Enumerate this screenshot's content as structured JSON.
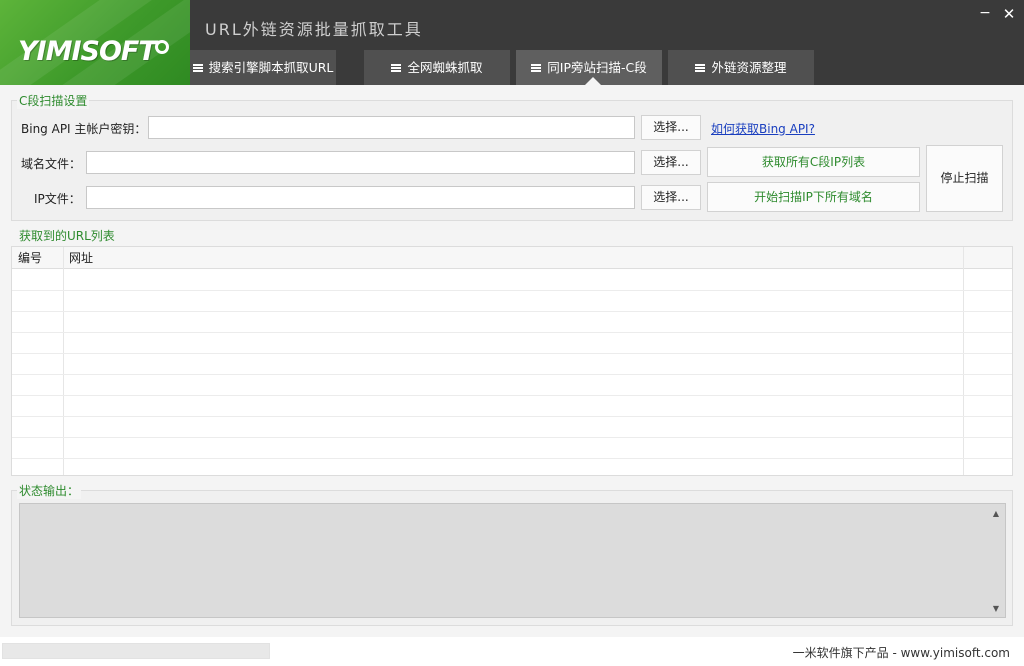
{
  "app": {
    "title": "URL外链资源批量抓取工具",
    "logo_text": "YIMISOFT",
    "minimize_symbol": "−",
    "close_symbol": "✕"
  },
  "tabs": [
    {
      "label": "搜索引擎脚本抓取URL",
      "active": false
    },
    {
      "label": "全网蜘蛛抓取",
      "active": false
    },
    {
      "label": "同IP旁站扫描-C段",
      "active": true
    },
    {
      "label": "外链资源整理",
      "active": false
    }
  ],
  "c_scan": {
    "group_title": "C段扫描设置",
    "bing_label": "Bing API 主帐户密钥：",
    "bing_value": "",
    "domain_label": "域名文件：",
    "domain_value": "",
    "ip_label": "IP文件：",
    "ip_value": "",
    "choose_label": "选择...",
    "help_link": "如何获取Bing API?",
    "get_c_ip_button": "获取所有C段IP列表",
    "scan_domains_button": "开始扫描IP下所有域名",
    "stop_button": "停止扫描"
  },
  "url_list": {
    "group_title": "获取到的URL列表",
    "columns": [
      "编号",
      "网址"
    ],
    "rows": []
  },
  "status": {
    "group_title": "状态输出：",
    "output": "",
    "scroll_up_symbol": "▲",
    "scroll_down_symbol": "▼"
  },
  "footer": {
    "text": "一米软件旗下产品 - www.yimisoft.com",
    "progress": 0
  },
  "colors": {
    "accent_green": "#2e8b2e",
    "header_bg": "#3a3a3a",
    "tab_bg": "#505050",
    "logo_green": "#3e9a2a",
    "link_blue": "#1a3fbf"
  }
}
